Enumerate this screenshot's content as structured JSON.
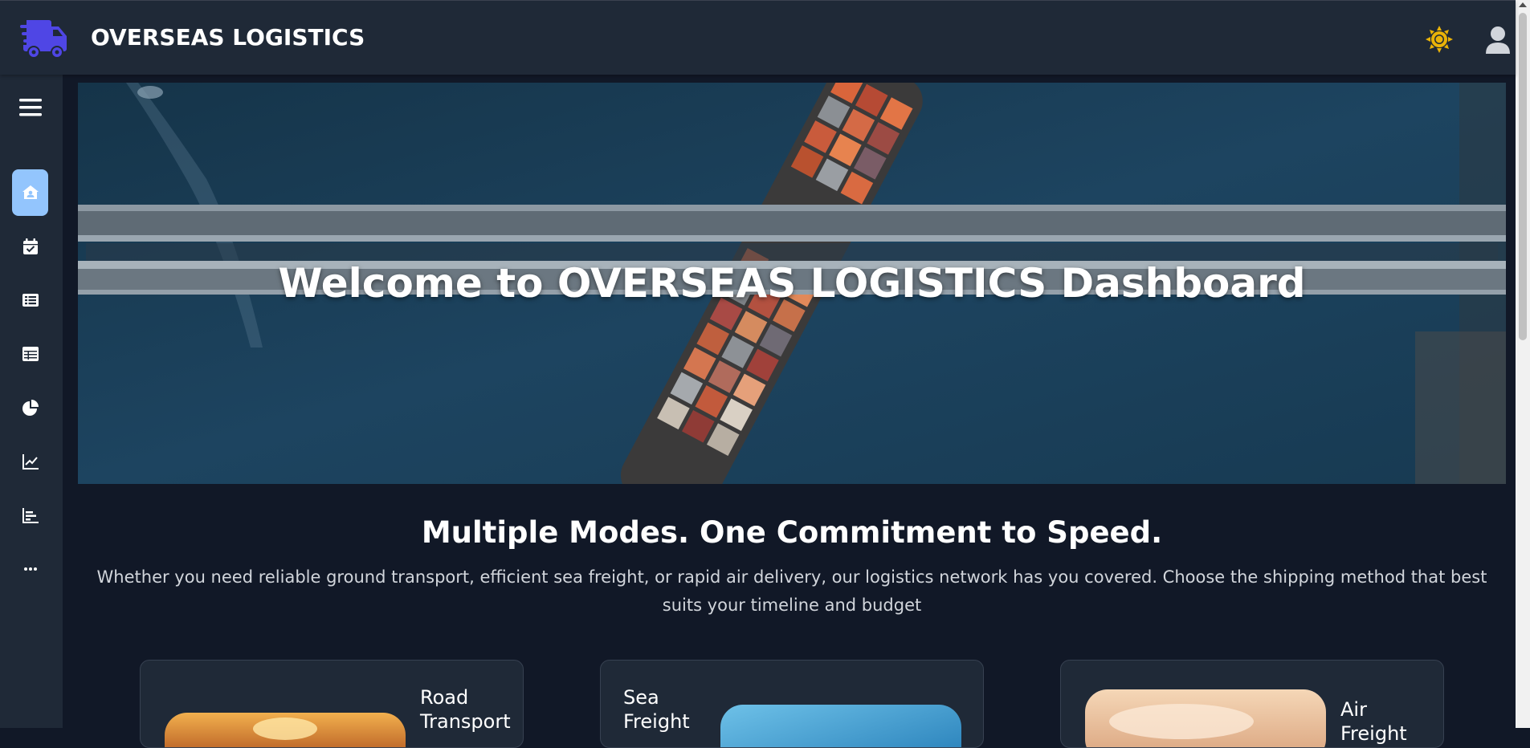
{
  "header": {
    "app_title": "OVERSEAS LOGISTICS",
    "logo_icon": "truck-fast-icon",
    "theme_toggle_icon": "sun-icon",
    "profile_icon": "user-icon"
  },
  "sidebar": {
    "menu_icon": "hamburger-menu-icon",
    "items": [
      {
        "icon": "home-icon",
        "active": true
      },
      {
        "icon": "calendar-check-icon",
        "active": false
      },
      {
        "icon": "list-icon",
        "active": false
      },
      {
        "icon": "table-icon",
        "active": false
      },
      {
        "icon": "pie-chart-icon",
        "active": false
      },
      {
        "icon": "line-chart-icon",
        "active": false
      },
      {
        "icon": "bar-chart-icon",
        "active": false
      },
      {
        "icon": "more-icon",
        "active": false
      }
    ]
  },
  "hero": {
    "title": "Welcome to OVERSEAS LOGISTICS Dashboard"
  },
  "section": {
    "title": "Multiple Modes. One Commitment to Speed.",
    "description": "Whether you need reliable ground transport, efficient sea freight, or rapid air delivery, our logistics network has you covered. Choose the shipping method that best suits your timeline and budget"
  },
  "cards": [
    {
      "title": "Road Transport"
    },
    {
      "title": "Sea Freight"
    },
    {
      "title": "Air Freight"
    }
  ],
  "colors": {
    "accent": "#4f46e5",
    "active_nav": "#93c5fd",
    "sun": "#eab308",
    "bg": "#111827",
    "panel": "#1f2937"
  }
}
